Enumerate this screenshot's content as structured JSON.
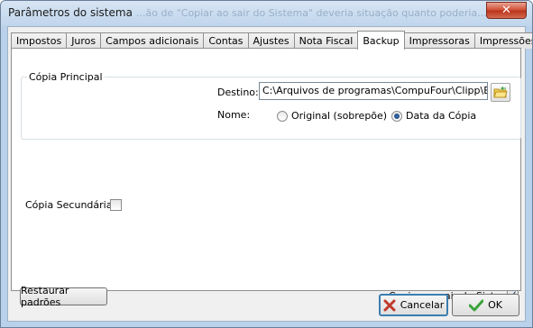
{
  "window": {
    "title": "Parâmetros do sistema",
    "ghost_title": "...ão de \"Copiar ao sair do Sistema\" deveria situação quanto poderia..."
  },
  "tabs": [
    {
      "label": "Impostos",
      "active": false
    },
    {
      "label": "Juros",
      "active": false
    },
    {
      "label": "Campos adicionais",
      "active": false
    },
    {
      "label": "Contas",
      "active": false
    },
    {
      "label": "Ajustes",
      "active": false
    },
    {
      "label": "Nota Fiscal",
      "active": false
    },
    {
      "label": "Backup",
      "active": true
    },
    {
      "label": "Impressoras",
      "active": false
    },
    {
      "label": "Impressões",
      "active": false
    }
  ],
  "primary_copy": {
    "group_title": "Cópia Principal",
    "destino_label": "Destino:",
    "destino_value": "C:\\Arquivos de programas\\CompuFour\\Clipp\\Exe",
    "nome_label": "Nome:",
    "option_original": "Original (sobrepõe)",
    "option_data": "Data da Cópia",
    "selected": "Data da Cópia"
  },
  "secondary_copy": {
    "label": "Cópia Secundária",
    "checked": false
  },
  "footer": {
    "restore_label": "Restaurar padrões",
    "copy_on_exit_label": "Copiar ao sair do Sistema",
    "copy_on_exit_checked": true
  },
  "buttons": {
    "cancel_label": "Cancelar",
    "ok_label": "OK"
  },
  "colors": {
    "accent": "#3c7fb1",
    "close_red": "#cf4a31",
    "ok_green": "#3aa33a",
    "cancel_red": "#c0392b"
  }
}
